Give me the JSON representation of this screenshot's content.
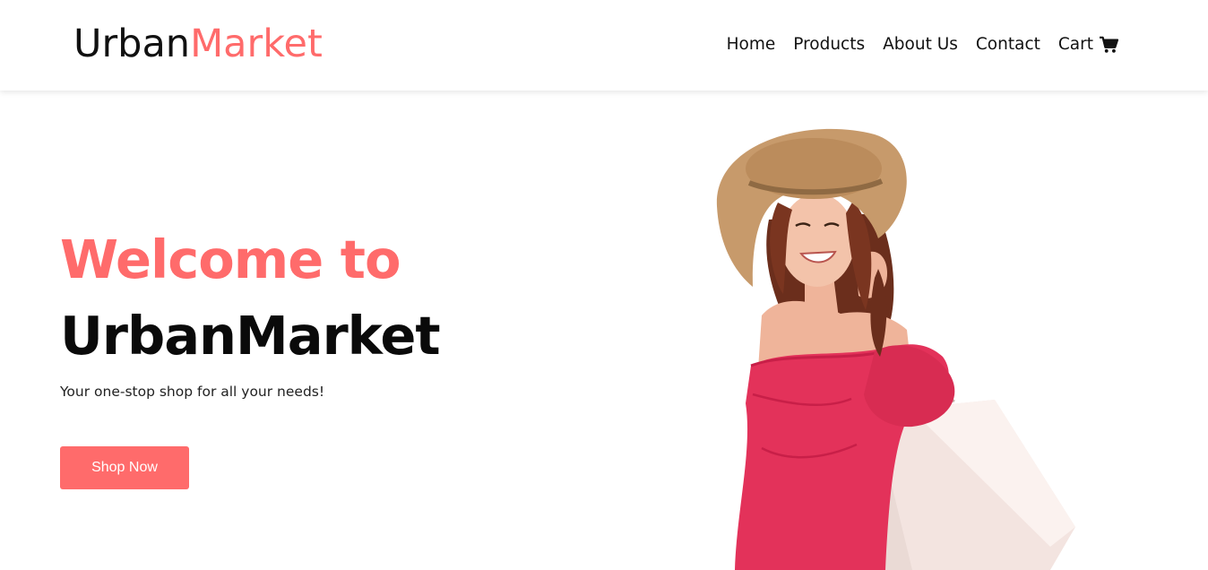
{
  "brand": {
    "primary": "Urban",
    "accent": "Market"
  },
  "nav": {
    "items": [
      "Home",
      "Products",
      "About Us",
      "Contact",
      "Cart"
    ],
    "cart_icon": "shopping-cart-icon"
  },
  "hero": {
    "welcome": "Welcome to",
    "title": "UrbanMarket",
    "tagline": "Your one-stop shop for all your needs!",
    "cta_label": "Shop Now",
    "image": "woman-with-shopping-bags"
  },
  "colors": {
    "accent": "#ff6b6b",
    "text": "#111111",
    "background": "#ffffff"
  }
}
